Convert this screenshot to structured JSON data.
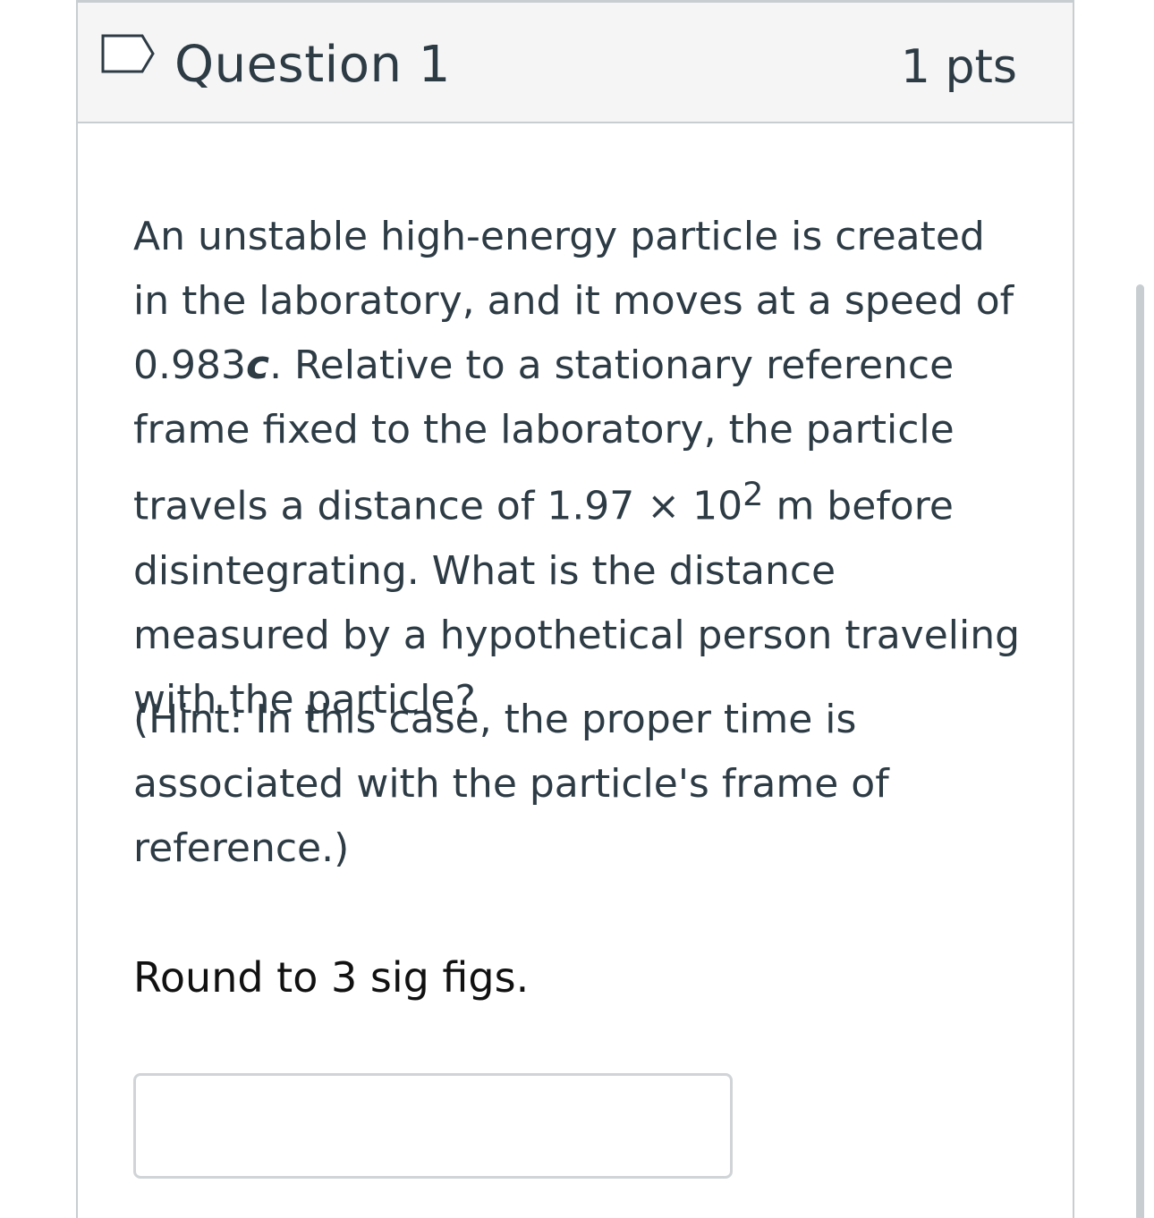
{
  "question": {
    "title": "Question 1",
    "points": "1 pts",
    "flag_icon": "flag-outline-icon",
    "text_before_c": "An unstable high-energy particle is created in the laboratory, and it moves at a speed of 0.983",
    "speed_symbol": "c",
    "text_after_c": ". Relative to a stationary reference frame fixed to the laboratory, the particle travels a distance of 1.97 × 10",
    "exponent": "2",
    "text_after_exponent": " m before disintegrating. What is the distance measured by a hypothetical person traveling with the particle?",
    "hint": "(Hint: In this case, the proper time is associated with the particle's frame of reference.)",
    "instruction": "Round to 3 sig figs."
  },
  "answer": {
    "value": "",
    "placeholder": ""
  },
  "colors": {
    "text": "#2d3b45",
    "border": "#c7cdd1",
    "header_bg": "#f5f5f5",
    "flag_stroke": "#2d3b45"
  }
}
